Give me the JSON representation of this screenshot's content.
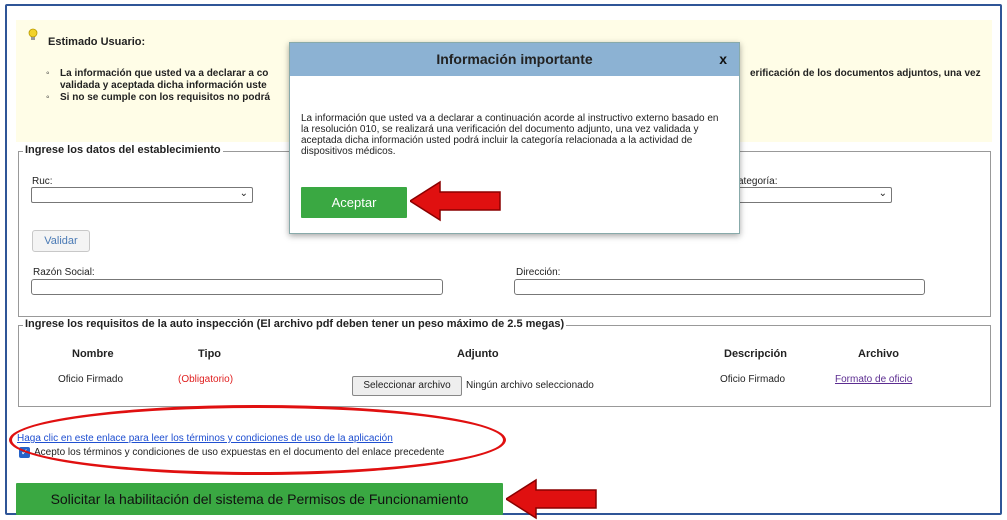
{
  "notice": {
    "greeting": "Estimado Usuario:",
    "item1_left": "La información que usted va a declarar a co",
    "item1_line2": "validada y aceptada dicha información uste",
    "item1_right": "erificación de los documentos adjuntos, una vez",
    "item2": "Si no se cumple con los requisitos no podrá"
  },
  "establecimiento": {
    "legend": "Ingrese los datos del establecimiento",
    "ruc_label": "Ruc:",
    "categoria_label": "ategoría:",
    "validar_label": "Validar",
    "razon_label": "Razón Social:",
    "direccion_label": "Dirección:"
  },
  "requisitos": {
    "legend": "Ingrese los requisitos de la auto inspección (El archivo pdf deben tener un peso máximo de 2.5 megas)",
    "headers": [
      "Nombre",
      "Tipo",
      "Adjunto",
      "Descripción",
      "Archivo"
    ],
    "row": {
      "nombre": "Oficio Firmado",
      "tipo": "(Obligatorio)",
      "file_button": "Seleccionar archivo",
      "file_status": "Ningún archivo seleccionado",
      "descripcion": "Oficio Firmado",
      "archivo_link": "Formato de oficio"
    }
  },
  "terms": {
    "link_text": "Haga clic en este enlace para leer los términos y condiciones de uso de la aplicación",
    "checkbox_label": "Acepto los términos y condiciones de uso expuestas en el documento del enlace precedente",
    "checked": true
  },
  "submit_label": "Solicitar la habilitación del sistema de Permisos de Funcionamiento",
  "modal": {
    "title": "Información importante",
    "close": "x",
    "body": "La información que usted va a declarar a continuación acorde al instructivo externo basado en la resolución 010, se realizará una verificación del documento adjunto, una vez validada y aceptada dicha información usted podrá incluir la categoría relacionada a la actividad de dispositivos médicos.",
    "accept_label": "Aceptar"
  },
  "colors": {
    "accent_green": "#3aa842",
    "modal_header": "#8cb2d3",
    "annotation_red": "#e01010",
    "notice_bg": "#fffde7"
  }
}
